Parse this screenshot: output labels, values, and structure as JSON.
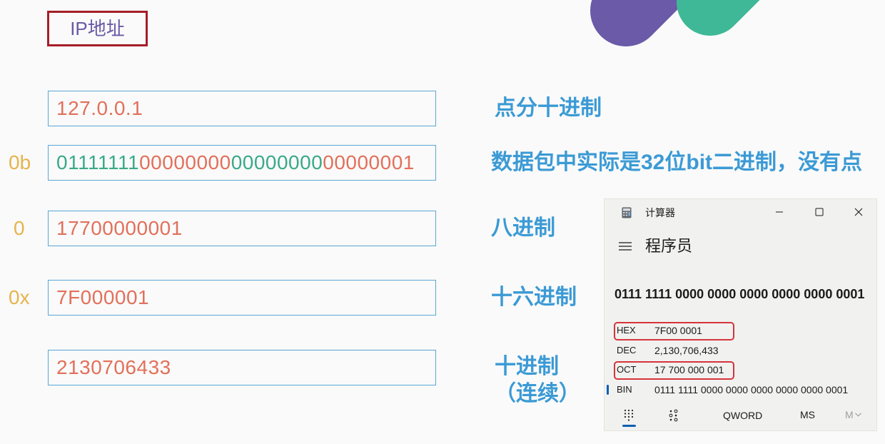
{
  "slide": {
    "title": "IP地址",
    "rows": [
      {
        "value": "127.0.0.1",
        "label": "点分十进制"
      },
      {
        "prefix": "0b",
        "value_segments": [
          "01111111",
          "00000000",
          "00000000",
          "00000001"
        ],
        "label": "数据包中实际是32位bit二进制，没有点"
      },
      {
        "prefix": "0",
        "value": "17700000001",
        "label": "八进制"
      },
      {
        "prefix": "0x",
        "value": "7F000001",
        "label": "十六进制"
      },
      {
        "value": "2130706433",
        "label": "十进制",
        "label_note": "（连续）"
      }
    ]
  },
  "calculator": {
    "window_title": "计算器",
    "mode_title": "程序员",
    "display_value": "0111 1111 0000 0000 0000 0000 0000 0001",
    "radix_rows": [
      {
        "label": "HEX",
        "value": "7F00 0001",
        "annotated": true,
        "selected": false
      },
      {
        "label": "DEC",
        "value": "2,130,706,433",
        "annotated": false,
        "selected": false
      },
      {
        "label": "OCT",
        "value": "17 700 000 001",
        "annotated": true,
        "selected": false
      },
      {
        "label": "BIN",
        "value": "0111 1111 0000 0000 0000 0000 0000 0001",
        "annotated": false,
        "selected": true
      }
    ],
    "toolbar": {
      "word_size": "QWORD",
      "memory_store": "MS",
      "memory_list": "M"
    },
    "icons": {
      "app": "calculator-icon",
      "menu": "hamburger-menu-icon",
      "minimize": "minimize-icon",
      "maximize": "maximize-icon",
      "close": "close-icon",
      "full_keypad": "keypad-icon",
      "bit_toggling": "bit-toggling-keypad-icon",
      "memory_dropdown": "chevron-down-icon"
    }
  },
  "colors": {
    "title_border": "#a51e28",
    "title_text": "#6a5aa6",
    "value_box_border": "#5aa7d3",
    "value_text": "#e2705a",
    "binary_alt_text": "#3aa988",
    "prefix_text": "#e6b44c",
    "label_text": "#3b9ad5",
    "decor_purple": "#6a5aa8",
    "decor_green": "#3fb897",
    "calc_background": "#f1f1ef",
    "annotation_red": "#d4353b",
    "calc_accent": "#0a5fb4"
  }
}
